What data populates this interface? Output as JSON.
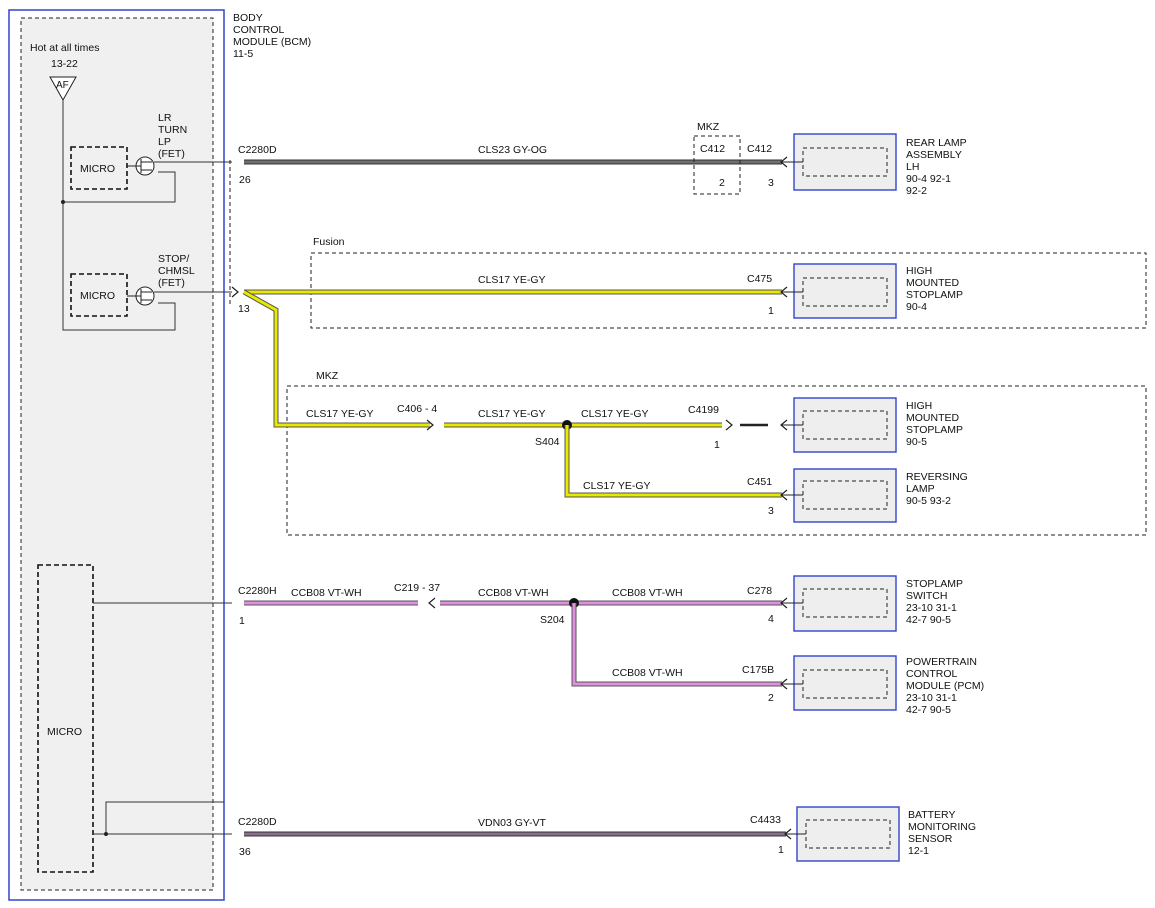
{
  "bcm": {
    "title_lines": [
      "BODY",
      "CONTROL",
      "MODULE (BCM)",
      "11-5"
    ],
    "hot_label": "Hot at all times",
    "fuse_ref": "13-22",
    "fuse_code": "AF",
    "micro_label": "MICRO",
    "lr_turn_lines": [
      "LR",
      "TURN",
      "LP",
      "(FET)"
    ],
    "stop_lines": [
      "STOP/",
      "CHMSL",
      "(FET)"
    ]
  },
  "groups": {
    "mkz_top": "MKZ",
    "fusion": "Fusion",
    "mkz_mid": "MKZ"
  },
  "circuits": {
    "c1": {
      "connector": "C2280D",
      "pin": "26",
      "wire": "CLS23   GY-OG",
      "inline_conn": "C412",
      "inline_pin": "2",
      "dest_conn": "C412",
      "dest_pin": "3"
    },
    "c2": {
      "pin": "13",
      "wire": "CLS17   YE-GY",
      "dest_conn": "C475",
      "dest_pin": "1"
    },
    "c3": {
      "wire_a": "CLS17   YE-GY",
      "mid_conn": "C406  -  4",
      "wire_b": "CLS17   YE-GY",
      "splice": "S404",
      "wire_c": "CLS17   YE-GY",
      "dest_conn": "C4199",
      "dest_pin": "1"
    },
    "c4": {
      "wire": "CLS17   YE-GY",
      "dest_conn": "C451",
      "dest_pin": "3"
    },
    "c5": {
      "connector": "C2280H",
      "pin": "1",
      "wire_a": "CCB08   VT-WH",
      "mid_conn": "C219  -  37",
      "wire_b": "CCB08   VT-WH",
      "splice": "S204",
      "wire_c": "CCB08   VT-WH",
      "dest_conn": "C278",
      "dest_pin": "4"
    },
    "c6": {
      "wire": "CCB08   VT-WH",
      "dest_conn": "C175B",
      "dest_pin": "2"
    },
    "c7": {
      "connector": "C2280D",
      "pin": "36",
      "wire": "VDN03   GY-VT",
      "dest_conn": "C4433",
      "dest_pin": "1"
    }
  },
  "components": {
    "rear_lamp": [
      "REAR LAMP",
      "ASSEMBLY",
      "LH",
      "90-4    92-1",
      "92-2"
    ],
    "hmsl_fusion": [
      "HIGH",
      "MOUNTED",
      "STOPLAMP",
      "90-4"
    ],
    "hmsl_mkz": [
      "HIGH",
      "MOUNTED",
      "STOPLAMP",
      "90-5"
    ],
    "reversing": [
      "REVERSING",
      "LAMP",
      "90-5    93-2"
    ],
    "stoplamp_switch": [
      "STOPLAMP",
      "SWITCH",
      "23-10   31-1",
      "42-7     90-5"
    ],
    "pcm": [
      "POWERTRAIN",
      "CONTROL",
      "MODULE (PCM)",
      "23-10   31-1",
      "42-7     90-5"
    ],
    "battery": [
      "BATTERY",
      "MONITORING",
      "SENSOR",
      "12-1"
    ]
  },
  "colors": {
    "gy_og": "#6f6f6f",
    "ye_gy": "#e8e800",
    "vt_wh": "#e08fe0",
    "gy_vt": "#8a6f8a",
    "frame_blue": "#3344cc"
  }
}
